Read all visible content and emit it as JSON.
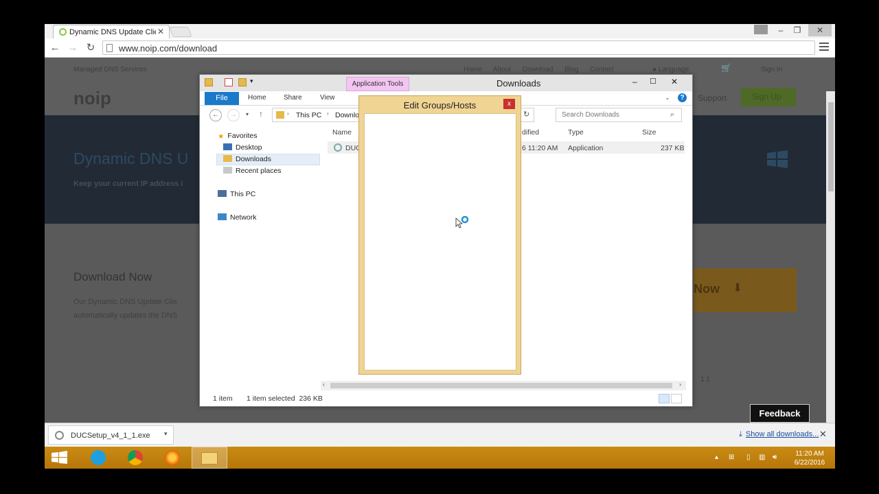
{
  "browser": {
    "tab_title": "Dynamic DNS Update Clie",
    "url": "www.noip.com/download"
  },
  "site": {
    "top_left": "Managed DNS Services",
    "nav": [
      "Home",
      "About",
      "Download",
      "Blog",
      "Contact"
    ],
    "language": "Language",
    "sign_in": "Sign In",
    "support": "Support",
    "sign_up": "Sign Up",
    "logo": "noip",
    "hero_title": "Dynamic DNS U",
    "hero_sub": "Keep your current IP address i",
    "download_heading": "Download Now",
    "download_text_1": "Our Dynamic DNS Update Clie",
    "download_text_2": "automatically updates the DNS",
    "download_button": "Now",
    "version_hint": "1 1"
  },
  "explorer": {
    "title": "Downloads",
    "app_tools": "Application Tools",
    "ribbon_tabs": [
      "File",
      "Home",
      "Share",
      "View"
    ],
    "breadcrumb": [
      "This PC",
      "Downlo"
    ],
    "search_placeholder": "Search Downloads",
    "nav": {
      "favorites": "Favorites",
      "desktop": "Desktop",
      "downloads": "Downloads",
      "recent": "Recent places",
      "this_pc": "This PC",
      "network": "Network"
    },
    "columns": [
      "Name",
      "dified",
      "Type",
      "Size"
    ],
    "file": {
      "name": "DUC",
      "date": "6 11:20 AM",
      "type": "Application",
      "size": "237 KB"
    },
    "status_items": "1 item",
    "status_selected": "1 item selected  236 KB"
  },
  "dialog": {
    "title": "Edit Groups/Hosts",
    "close": "x"
  },
  "download_shelf": {
    "filename": "DUCSetup_v4_1_1.exe",
    "show_all": "Show all downloads..."
  },
  "feedback": "Feedback",
  "taskbar": {
    "time": "11:20 AM",
    "date": "6/22/2016"
  }
}
